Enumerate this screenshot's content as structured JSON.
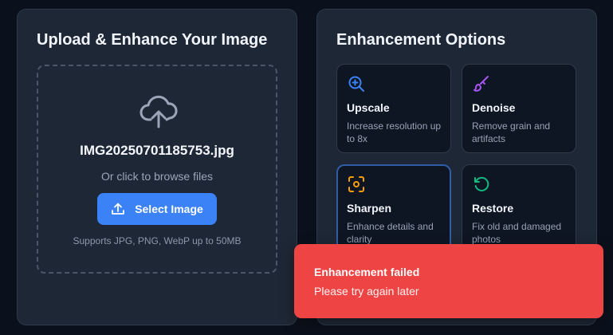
{
  "upload": {
    "title": "Upload & Enhance Your Image",
    "filename": "IMG20250701185753.jpg",
    "browse_text": "Or click to browse files",
    "button_label": "Select Image",
    "supports_text": "Supports JPG, PNG, WebP up to 50MB",
    "icon": "cloud-upload-icon"
  },
  "options": {
    "title": "Enhancement Options",
    "items": [
      {
        "title": "Upscale",
        "desc": "Increase resolution up to 8x",
        "icon": "zoom-in-icon",
        "color": "#3b82f6",
        "selected": false
      },
      {
        "title": "Denoise",
        "desc": "Remove grain and artifacts",
        "icon": "brush-icon",
        "color": "#a855f7",
        "selected": false
      },
      {
        "title": "Sharpen",
        "desc": "Enhance details and clarity",
        "icon": "focus-icon",
        "color": "#f59e0b",
        "selected": true
      },
      {
        "title": "Restore",
        "desc": "Fix old and damaged photos",
        "icon": "rotate-ccw-icon",
        "color": "#10b981",
        "selected": false
      }
    ]
  },
  "toast": {
    "title": "Enhancement failed",
    "message": "Please try again later",
    "color": "#ef4444"
  }
}
